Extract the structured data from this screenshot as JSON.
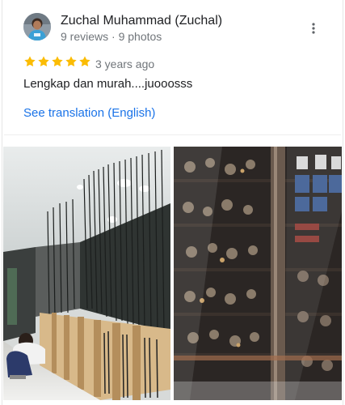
{
  "review": {
    "author_name": "Zuchal Muhammad (Zuchal)",
    "author_meta": "9 reviews · 9 photos",
    "rating": 5,
    "rating_max": 5,
    "time_ago": "3 years ago",
    "text": "Lengkap dan murah....juooosss",
    "translate_label": "See translation (English)"
  },
  "icons": {
    "more": "more-vert-icon",
    "star": "star-icon"
  },
  "colors": {
    "star": "#fbbc04",
    "link": "#1a73e8",
    "primary_text": "#202124",
    "secondary_text": "#70757a"
  },
  "photos": [
    {
      "subject": "shop-interior-fishing-rods"
    },
    {
      "subject": "glass-display-case-reels"
    }
  ]
}
